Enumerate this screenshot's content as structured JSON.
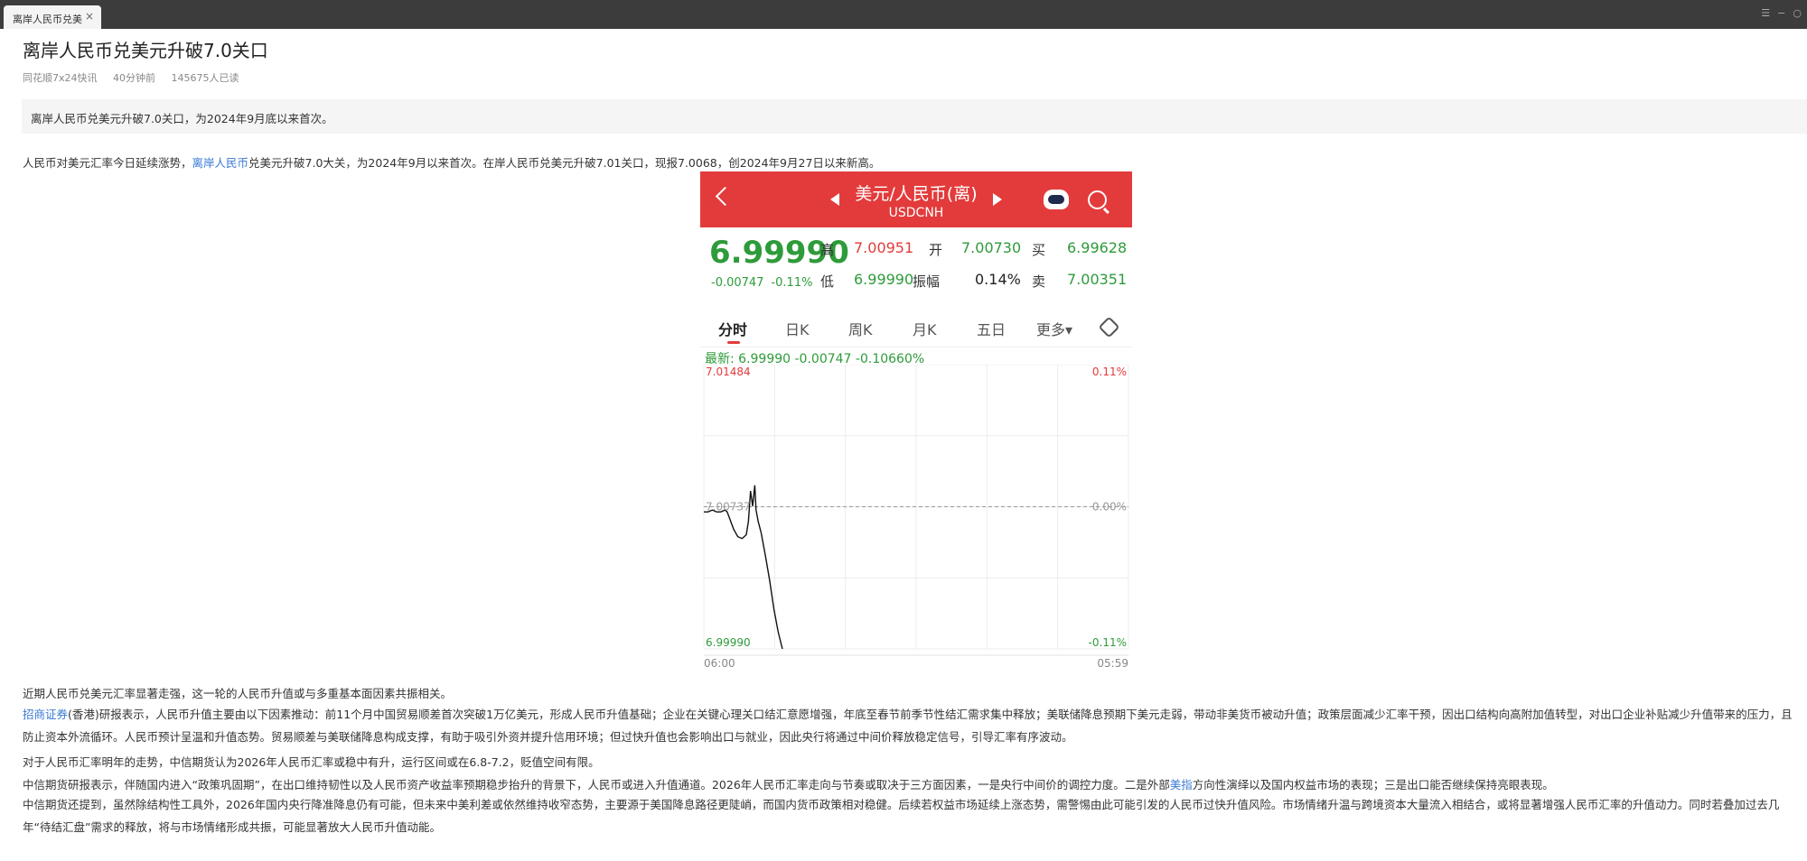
{
  "tab": {
    "label": "离岸人民币兑美",
    "close": "×"
  },
  "window_controls": [
    "☰",
    "−",
    "○"
  ],
  "article": {
    "title": "离岸人民币兑美元升破7.0关口",
    "meta": {
      "source": "同花顺7x24快讯",
      "time": "40分钟前",
      "reads": "145675人已读"
    },
    "summary": "离岸人民币兑美元升破7.0关口，为2024年9月底以来首次。",
    "para1": {
      "before": "人民币对美元汇率今日延续涨势，",
      "link": "离岸人民币",
      "after": "兑美元升破7.0大关，为2024年9月以来首次。在岸人民币兑美元升破7.01关口，现报7.0068，创2024年9月27日以来新高。"
    },
    "para2": "近期人民币兑美元汇率显著走强，这一轮的人民币升值或与多重基本面因素共振相关。",
    "para3": {
      "link": "招商证券",
      "after": "(香港)研报表示，人民币升值主要由以下因素推动：前11个月中国贸易顺差首次突破1万亿美元，形成人民币升值基础；企业在关键心理关口结汇意愿增强，年底至春节前季节性结汇需求集中释放；美联储降息预期下美元走弱，带动非美货币被动升值；政策层面减少汇率干预，因出口结构向高附加值转型，对出口企业补贴减少升值带来的压力，且防止资本外流循环。人民币预计呈温和升值态势。贸易顺差与美联储降息构成支撑，有助于吸引外资并提升信用环境；但过快升值也会影响出口与就业，因此央行将通过中间价释放稳定信号，引导汇率有序波动。"
    },
    "para4": "对于人民币汇率明年的走势，中信期货认为2026年人民币汇率或稳中有升，运行区间或在6.8-7.2，贬值空间有限。",
    "para5": {
      "before": "中信期货研报表示，伴随国内进入“政策巩固期”，在出口维持韧性以及人民币资产收益率预期稳步抬升的背景下，人民币或进入升值通道。2026年人民币汇率走向与节奏或取决于三方面因素，一是央行中间价的调控力度。二是外部",
      "link": "美指",
      "after": "方向性演绎以及国内权益市场的表现；三是出口能否继续保持亮眼表现。"
    },
    "para6": "中信期货还提到，虽然除结构性工具外，2026年国内央行降准降息仍有可能，但未来中美利差或依然维持收窄态势，主要源于美国降息路径更陡峭，而国内货币政策相对稳健。后续若权益市场延续上涨态势，需警惕由此可能引发的人民币过快升值风险。市场情绪升温与跨境资本大量流入相结合，或将显著增强人民币汇率的升值动力。同时若叠加过去几年“待结汇盘”需求的释放，将与市场情绪形成共振，可能显著放大人民币升值动能。"
  },
  "quote": {
    "title": "美元/人民币(离)",
    "code": "USDCNH",
    "price": "6.99990",
    "change": "-0.00747",
    "change_pct": "-0.11%",
    "stats": {
      "high_label": "高",
      "high": "7.00951",
      "open_label": "开",
      "open": "7.00730",
      "bid_label": "买",
      "bid": "6.99628",
      "low_label": "低",
      "low": "6.99990",
      "amp_label": "振幅",
      "amp": "0.14%",
      "ask_label": "卖",
      "ask": "7.00351"
    },
    "tabs": [
      "分时",
      "日K",
      "周K",
      "月K",
      "五日",
      "更多▾"
    ],
    "latest": "最新: 6.99990  -0.00747  -0.10660%",
    "colors": {
      "up": "#e33b3b",
      "down": "#2e9b3a",
      "header": "#e33b3b"
    }
  },
  "chart_data": {
    "type": "line",
    "title": "",
    "xlabel": "",
    "ylabel": "",
    "x_ticks": [
      "06:00",
      "05:59"
    ],
    "y_top_label": "7.01484",
    "y_mid_label": "7.00737",
    "y_bottom_label": "6.99990",
    "pct_top_label": "0.11%",
    "pct_mid_label": "0.00%",
    "pct_bottom_label": "-0.11%",
    "ylim": [
      6.9999,
      7.01484
    ],
    "x_range": [
      0,
      100
    ],
    "grid": true,
    "series": [
      {
        "values": [
          [
            0,
            7.0071
          ],
          [
            1,
            7.0071
          ],
          [
            2,
            7.0072
          ],
          [
            3,
            7.0071
          ],
          [
            4,
            7.0071
          ],
          [
            5,
            7.0072
          ],
          [
            5.5,
            7.0071
          ],
          [
            6,
            7.0068
          ],
          [
            7,
            7.0062
          ],
          [
            8,
            7.0058
          ],
          [
            9,
            7.0057
          ],
          [
            10,
            7.0059
          ],
          [
            10.5,
            7.0066
          ],
          [
            11,
            7.0082
          ],
          [
            11.5,
            7.0074
          ],
          [
            12,
            7.0085
          ],
          [
            12.3,
            7.0072
          ],
          [
            12.8,
            7.0066
          ],
          [
            13.5,
            7.006
          ],
          [
            14.5,
            7.0048
          ],
          [
            15.5,
            7.0035
          ],
          [
            16.5,
            7.002
          ],
          [
            17.5,
            7.0008
          ],
          [
            18.5,
            6.9999
          ]
        ]
      }
    ]
  }
}
